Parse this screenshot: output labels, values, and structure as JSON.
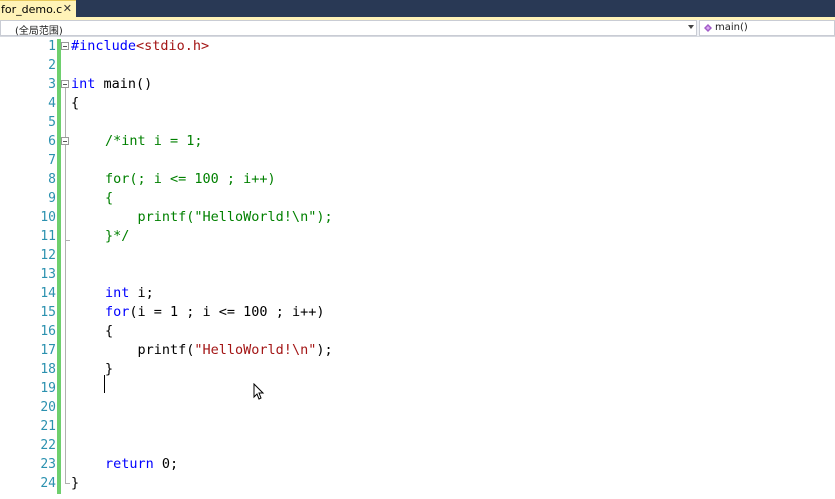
{
  "tab": {
    "label": "for_demo.c",
    "close_glyph": "✕"
  },
  "navigation": {
    "scope_label": "(全局范围)",
    "member_label": "main()",
    "member_icon": "method-icon"
  },
  "editor": {
    "line_numbers": [
      "1",
      "2",
      "3",
      "4",
      "5",
      "6",
      "7",
      "8",
      "9",
      "10",
      "11",
      "12",
      "13",
      "14",
      "15",
      "16",
      "17",
      "18",
      "19",
      "20",
      "21",
      "22",
      "23",
      "24"
    ],
    "code": {
      "l1_directive": "#include",
      "l1_header": "<stdio.h>",
      "l3_type": "int",
      "l3_rest": " main()",
      "l4": "{",
      "l6_comment": "/*int i = 1;",
      "l8_comment": "for(; i <= 100 ; i++)",
      "l9_comment": "{",
      "l10_comment": "    printf(\"HelloWorld!\\n\");",
      "l11_comment": "}*/",
      "l14_type": "int",
      "l14_rest": " i;",
      "l15_kw": "for",
      "l15_rest": "(i = 1 ; i <= 100 ; i++)",
      "l16": "{",
      "l17_fn": "    printf(",
      "l17_str": "\"HelloWorld!\\n\"",
      "l17_end": ");",
      "l18": "}",
      "l23_kw": "return",
      "l23_rest": " 0;",
      "l24": "}"
    },
    "colors": {
      "keyword": "#0000ff",
      "string": "#a31515",
      "comment": "#008000",
      "line_number": "#2b91af",
      "change_bar": "#6ecf6e",
      "tab_active": "#fff3b8",
      "tab_strip": "#293955"
    }
  }
}
